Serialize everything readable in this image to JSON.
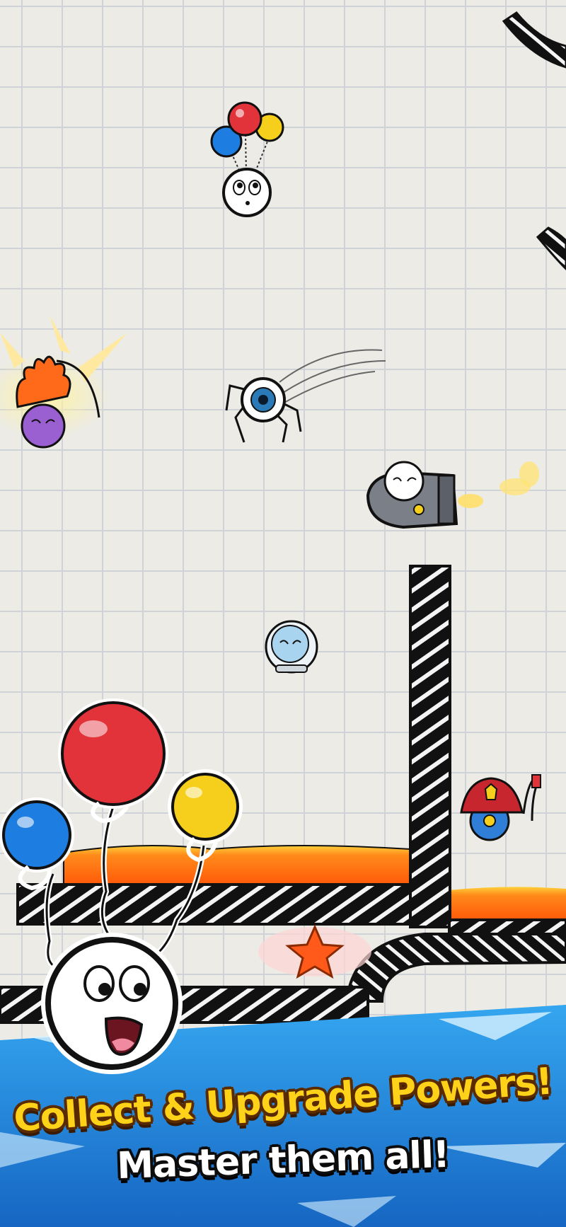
{
  "promo": {
    "headline": "Collect & Upgrade Powers!",
    "subheadline": "Master them all!"
  },
  "colors": {
    "balloon_red": "#e2323a",
    "balloon_blue": "#1e7de0",
    "balloon_yellow": "#f5cf1c",
    "lava": "#ff6a12",
    "banner_blue": "#1a87d8",
    "headline_yellow": "#ffd21a"
  },
  "icons": [
    "balloon-character",
    "fire-hair-character",
    "spider-eye-character",
    "rocket-character",
    "astronaut-character",
    "firefighter-character",
    "star-pickup",
    "hero-balloon-character"
  ]
}
